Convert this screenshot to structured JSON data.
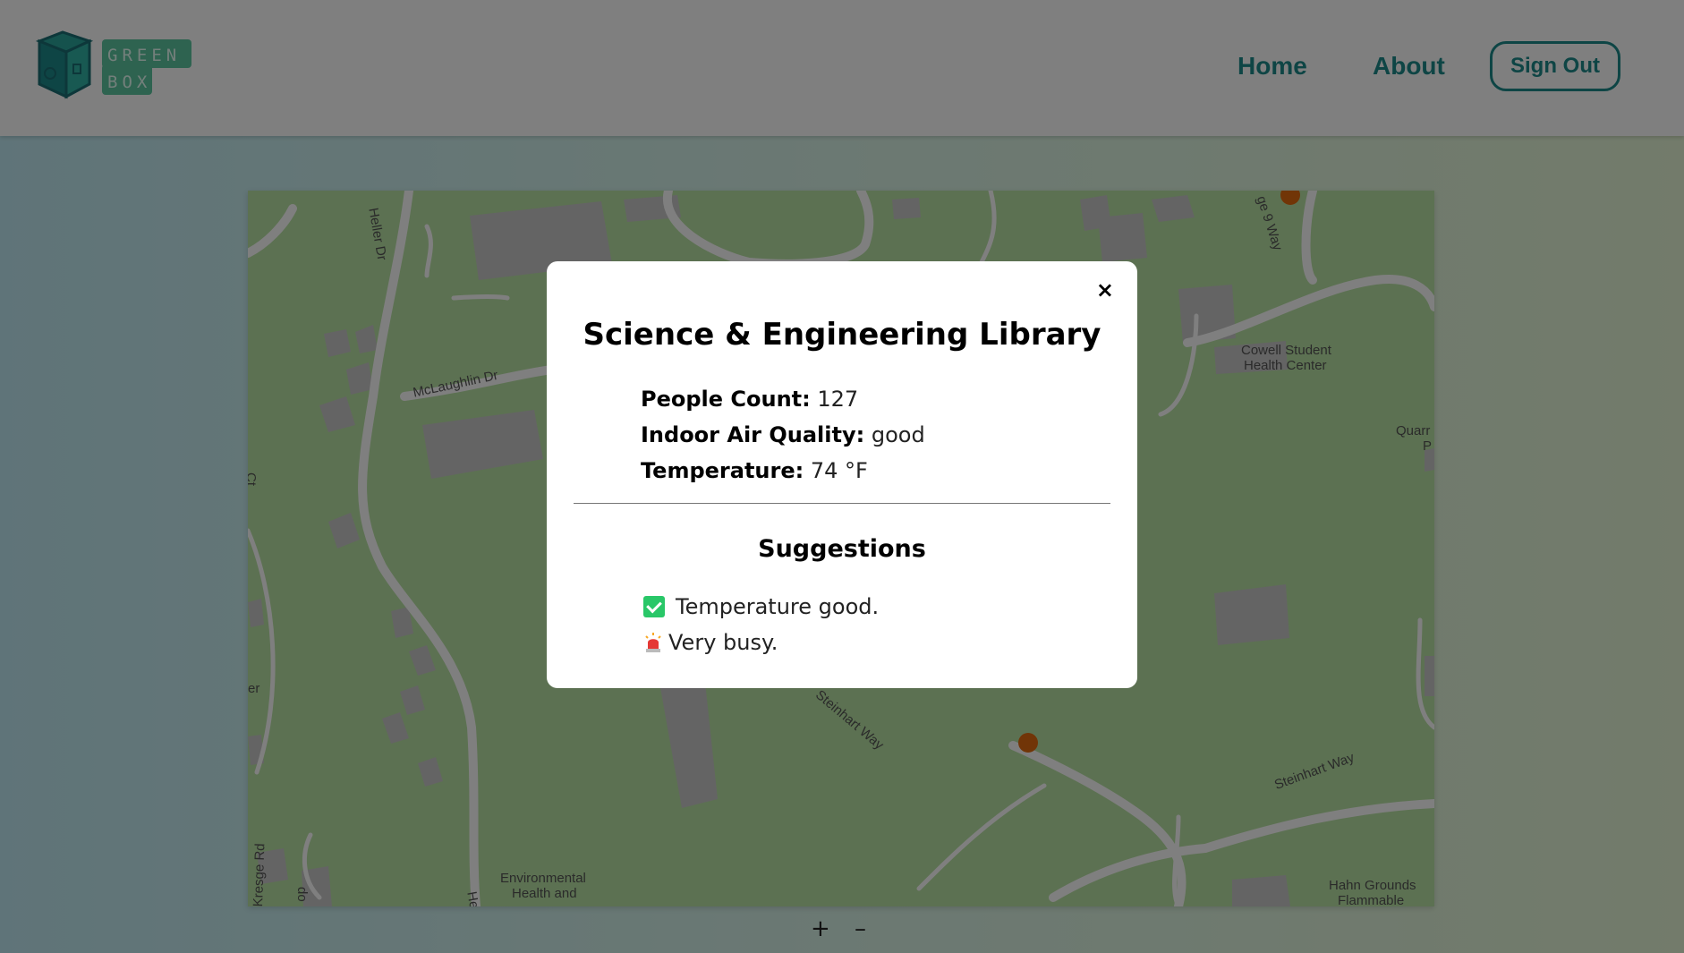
{
  "header": {
    "logo_text_line1": "GREEN",
    "logo_text_line2": "BOX",
    "nav": {
      "home": "Home",
      "about": "About",
      "sign_out": "Sign Out"
    }
  },
  "map": {
    "labels": {
      "heller": "Heller Dr",
      "mclaughlin": "McLaughlin Dr",
      "cowell": "Cowell Student",
      "cowell2": "Health Center",
      "quarry": "Quarr",
      "quarry2": "P",
      "way9": "ge 9 Way",
      "steinhart1": "Steinhart Way",
      "steinhart2": "Steinhart Way",
      "env1": "Environmental",
      "env2": "Health and",
      "hahn1": "Hahn Grounds",
      "hahn2": "Flammable",
      "kresge": "Kresge Rd",
      "ct": "Ct",
      "er": "er",
      "do": "do",
      "h": "He"
    },
    "zoom_in": "+",
    "zoom_out": "–"
  },
  "modal": {
    "close": "×",
    "title": "Science & Engineering Library",
    "stats": {
      "people_label": "People Count:",
      "people_value": "127",
      "air_label": "Indoor Air Quality:",
      "air_value": "good",
      "temp_label": "Temperature:",
      "temp_value": "74 °F"
    },
    "suggestions_title": "Suggestions",
    "suggestions": [
      "Temperature good.",
      "Very busy."
    ]
  },
  "colors": {
    "brand": "#1d8a8a",
    "map_bg": "#b9e3a4",
    "marker": "#e36b0e",
    "check": "#29c768"
  }
}
